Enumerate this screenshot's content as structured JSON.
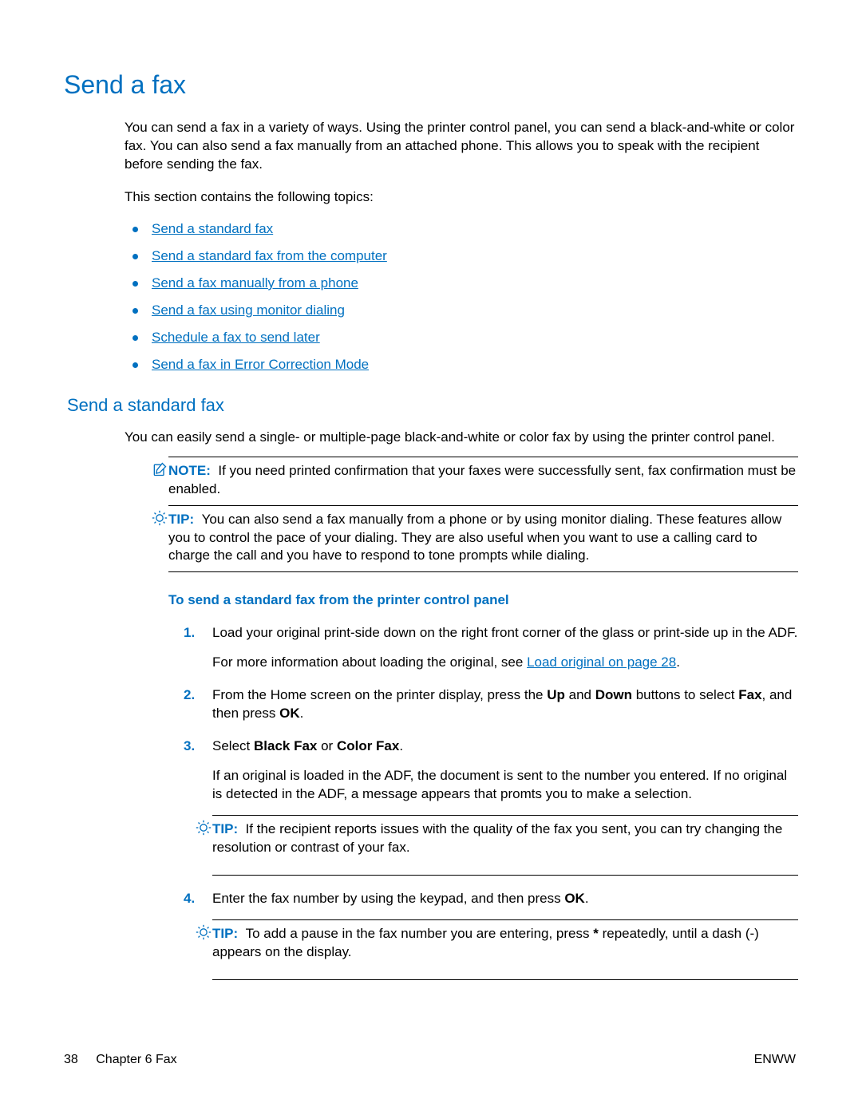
{
  "h1": "Send a fax",
  "intro1": "You can send a fax in a variety of ways. Using the printer control panel, you can send a black-and-white or color fax. You can also send a fax manually from an attached phone. This allows you to speak with the recipient before sending the fax.",
  "intro2": "This section contains the following topics:",
  "topics": [
    "Send a standard fax",
    "Send a standard fax from the computer",
    "Send a fax manually from a phone",
    "Send a fax using monitor dialing",
    "Schedule a fax to send later",
    "Send a fax in Error Correction Mode"
  ],
  "h2": "Send a standard fax",
  "body1": "You can easily send a single- or multiple-page black-and-white or color fax by using the printer control panel.",
  "note_label": "NOTE:",
  "note_text": "If you need printed confirmation that your faxes were successfully sent, fax confirmation must be enabled.",
  "tip_label": "TIP:",
  "tip1": "You can also send a fax manually from a phone or by using monitor dialing. These features allow you to control the pace of your dialing. They are also useful when you want to use a calling card to charge the call and you have to respond to tone prompts while dialing.",
  "subhead": "To send a standard fax from the printer control panel",
  "step1a": "Load your original print-side down on the right front corner of the glass or print-side up in the ADF.",
  "step1b_pre": "For more information about loading the original, see ",
  "step1b_link": "Load original on page 28",
  "step1b_post": ".",
  "step2_pre": "From the Home screen on the printer display, press the ",
  "step2_b1": "Up",
  "step2_mid1": " and ",
  "step2_b2": "Down",
  "step2_mid2": " buttons to select ",
  "step2_b3": "Fax",
  "step2_mid3": ", and then press ",
  "step2_b4": "OK",
  "step2_post": ".",
  "step3_pre": "Select ",
  "step3_b1": "Black Fax",
  "step3_mid": " or ",
  "step3_b2": "Color Fax",
  "step3_post": ".",
  "step3_body": "If an original is loaded in the ADF, the document is sent to the number you entered. If no original is detected in the ADF, a message appears that promts you to make a selection.",
  "tip2": "If the recipient reports issues with the quality of the fax you sent, you can try changing the resolution or contrast of your fax.",
  "step4_pre": "Enter the fax number by using the keypad, and then press ",
  "step4_b1": "OK",
  "step4_post": ".",
  "tip3_pre": "To add a pause in the fax number you are entering, press ",
  "tip3_b1": "*",
  "tip3_post": " repeatedly, until a dash (-) appears on the display.",
  "footer_page": "38",
  "footer_chapter": "Chapter 6   Fax",
  "footer_lang": "ENWW"
}
